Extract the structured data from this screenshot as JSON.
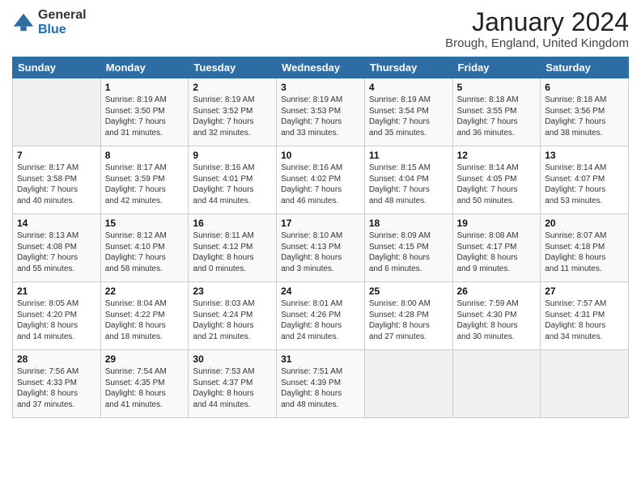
{
  "logo": {
    "general": "General",
    "blue": "Blue"
  },
  "title": {
    "month": "January 2024",
    "location": "Brough, England, United Kingdom"
  },
  "headers": [
    "Sunday",
    "Monday",
    "Tuesday",
    "Wednesday",
    "Thursday",
    "Friday",
    "Saturday"
  ],
  "weeks": [
    [
      {
        "day": "",
        "info": ""
      },
      {
        "day": "1",
        "info": "Sunrise: 8:19 AM\nSunset: 3:50 PM\nDaylight: 7 hours\nand 31 minutes."
      },
      {
        "day": "2",
        "info": "Sunrise: 8:19 AM\nSunset: 3:52 PM\nDaylight: 7 hours\nand 32 minutes."
      },
      {
        "day": "3",
        "info": "Sunrise: 8:19 AM\nSunset: 3:53 PM\nDaylight: 7 hours\nand 33 minutes."
      },
      {
        "day": "4",
        "info": "Sunrise: 8:19 AM\nSunset: 3:54 PM\nDaylight: 7 hours\nand 35 minutes."
      },
      {
        "day": "5",
        "info": "Sunrise: 8:18 AM\nSunset: 3:55 PM\nDaylight: 7 hours\nand 36 minutes."
      },
      {
        "day": "6",
        "info": "Sunrise: 8:18 AM\nSunset: 3:56 PM\nDaylight: 7 hours\nand 38 minutes."
      }
    ],
    [
      {
        "day": "7",
        "info": "Sunrise: 8:17 AM\nSunset: 3:58 PM\nDaylight: 7 hours\nand 40 minutes."
      },
      {
        "day": "8",
        "info": "Sunrise: 8:17 AM\nSunset: 3:59 PM\nDaylight: 7 hours\nand 42 minutes."
      },
      {
        "day": "9",
        "info": "Sunrise: 8:16 AM\nSunset: 4:01 PM\nDaylight: 7 hours\nand 44 minutes."
      },
      {
        "day": "10",
        "info": "Sunrise: 8:16 AM\nSunset: 4:02 PM\nDaylight: 7 hours\nand 46 minutes."
      },
      {
        "day": "11",
        "info": "Sunrise: 8:15 AM\nSunset: 4:04 PM\nDaylight: 7 hours\nand 48 minutes."
      },
      {
        "day": "12",
        "info": "Sunrise: 8:14 AM\nSunset: 4:05 PM\nDaylight: 7 hours\nand 50 minutes."
      },
      {
        "day": "13",
        "info": "Sunrise: 8:14 AM\nSunset: 4:07 PM\nDaylight: 7 hours\nand 53 minutes."
      }
    ],
    [
      {
        "day": "14",
        "info": "Sunrise: 8:13 AM\nSunset: 4:08 PM\nDaylight: 7 hours\nand 55 minutes."
      },
      {
        "day": "15",
        "info": "Sunrise: 8:12 AM\nSunset: 4:10 PM\nDaylight: 7 hours\nand 58 minutes."
      },
      {
        "day": "16",
        "info": "Sunrise: 8:11 AM\nSunset: 4:12 PM\nDaylight: 8 hours\nand 0 minutes."
      },
      {
        "day": "17",
        "info": "Sunrise: 8:10 AM\nSunset: 4:13 PM\nDaylight: 8 hours\nand 3 minutes."
      },
      {
        "day": "18",
        "info": "Sunrise: 8:09 AM\nSunset: 4:15 PM\nDaylight: 8 hours\nand 6 minutes."
      },
      {
        "day": "19",
        "info": "Sunrise: 8:08 AM\nSunset: 4:17 PM\nDaylight: 8 hours\nand 9 minutes."
      },
      {
        "day": "20",
        "info": "Sunrise: 8:07 AM\nSunset: 4:18 PM\nDaylight: 8 hours\nand 11 minutes."
      }
    ],
    [
      {
        "day": "21",
        "info": "Sunrise: 8:05 AM\nSunset: 4:20 PM\nDaylight: 8 hours\nand 14 minutes."
      },
      {
        "day": "22",
        "info": "Sunrise: 8:04 AM\nSunset: 4:22 PM\nDaylight: 8 hours\nand 18 minutes."
      },
      {
        "day": "23",
        "info": "Sunrise: 8:03 AM\nSunset: 4:24 PM\nDaylight: 8 hours\nand 21 minutes."
      },
      {
        "day": "24",
        "info": "Sunrise: 8:01 AM\nSunset: 4:26 PM\nDaylight: 8 hours\nand 24 minutes."
      },
      {
        "day": "25",
        "info": "Sunrise: 8:00 AM\nSunset: 4:28 PM\nDaylight: 8 hours\nand 27 minutes."
      },
      {
        "day": "26",
        "info": "Sunrise: 7:59 AM\nSunset: 4:30 PM\nDaylight: 8 hours\nand 30 minutes."
      },
      {
        "day": "27",
        "info": "Sunrise: 7:57 AM\nSunset: 4:31 PM\nDaylight: 8 hours\nand 34 minutes."
      }
    ],
    [
      {
        "day": "28",
        "info": "Sunrise: 7:56 AM\nSunset: 4:33 PM\nDaylight: 8 hours\nand 37 minutes."
      },
      {
        "day": "29",
        "info": "Sunrise: 7:54 AM\nSunset: 4:35 PM\nDaylight: 8 hours\nand 41 minutes."
      },
      {
        "day": "30",
        "info": "Sunrise: 7:53 AM\nSunset: 4:37 PM\nDaylight: 8 hours\nand 44 minutes."
      },
      {
        "day": "31",
        "info": "Sunrise: 7:51 AM\nSunset: 4:39 PM\nDaylight: 8 hours\nand 48 minutes."
      },
      {
        "day": "",
        "info": ""
      },
      {
        "day": "",
        "info": ""
      },
      {
        "day": "",
        "info": ""
      }
    ]
  ]
}
